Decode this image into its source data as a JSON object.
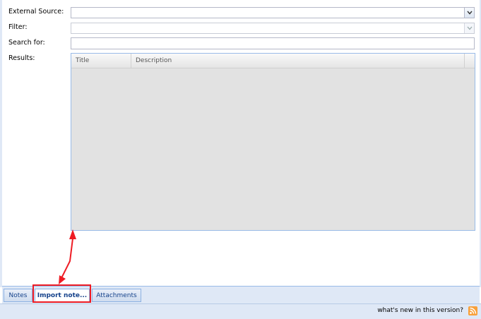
{
  "form": {
    "external_source_label": "External Source:",
    "filter_label": "Filter:",
    "search_label": "Search for:",
    "results_label": "Results:"
  },
  "grid": {
    "columns": [
      "Title",
      "Description"
    ]
  },
  "tabs": [
    {
      "label": "Notes"
    },
    {
      "label": "Import note..."
    },
    {
      "label": "Attachments"
    }
  ],
  "footer": {
    "whats_new": "what's new in this version?"
  },
  "colors": {
    "accent": "#15428b",
    "highlight": "#ee1c24",
    "panel": "#dfe8f6",
    "grid_bg": "#e2e2e2"
  }
}
